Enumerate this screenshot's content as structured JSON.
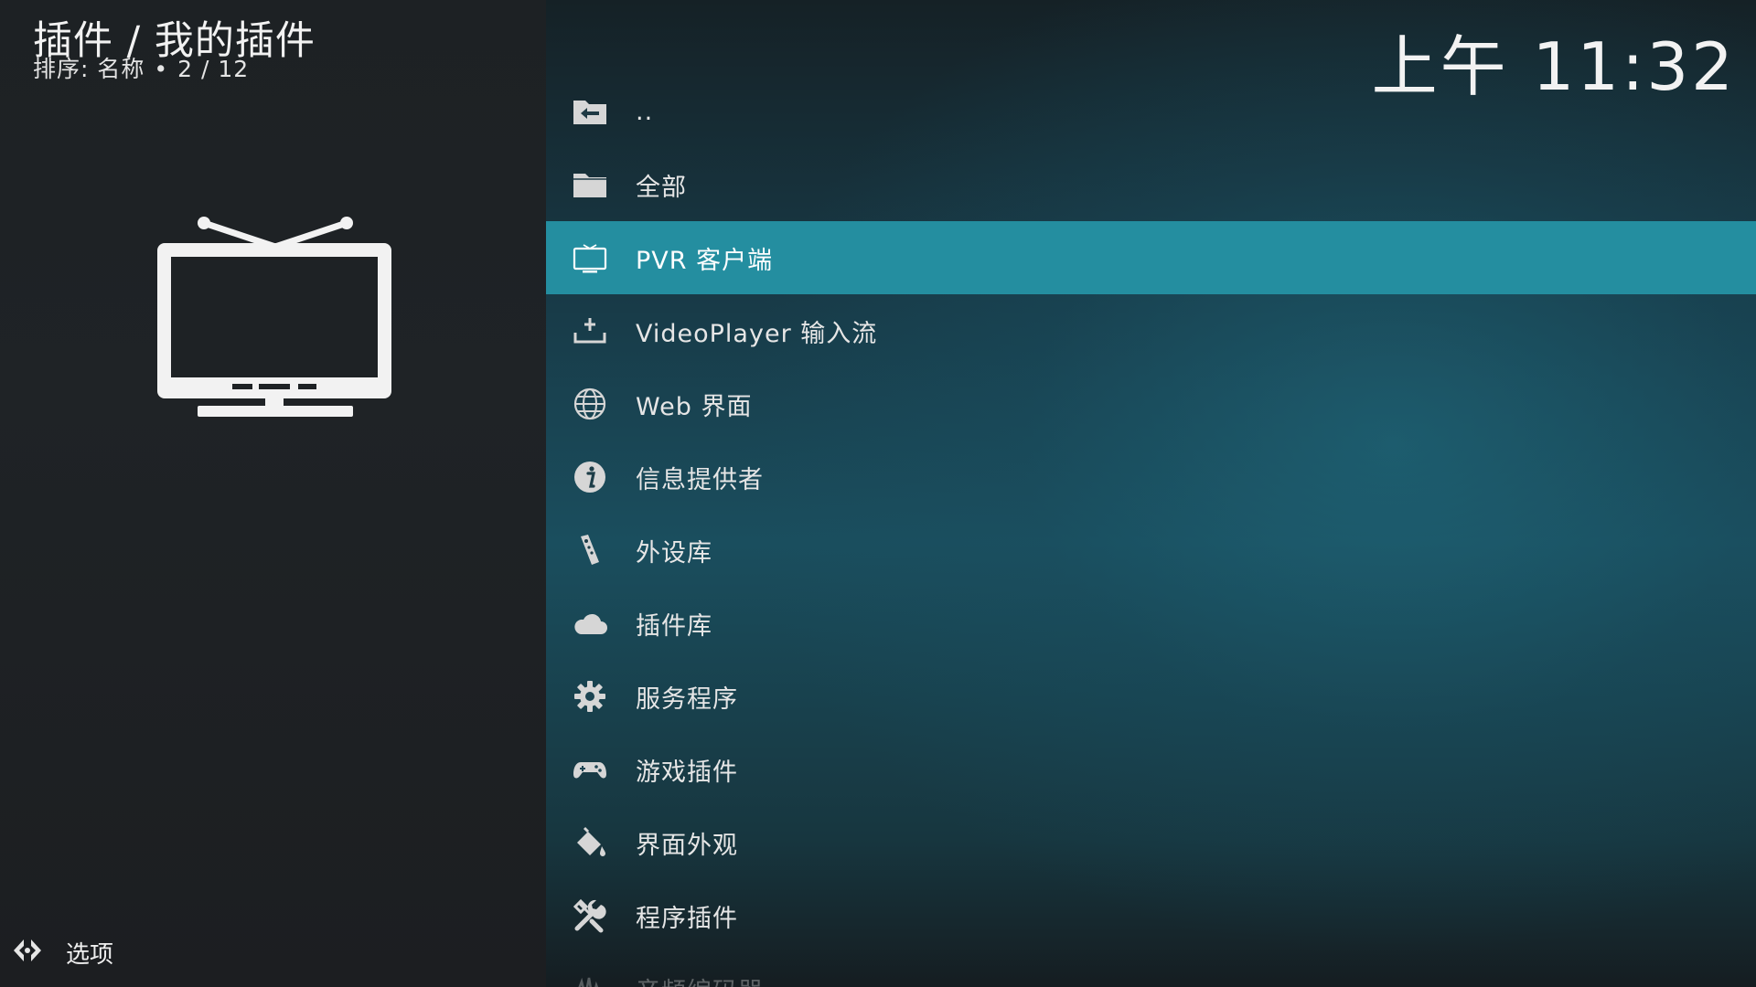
{
  "header": {
    "title": "插件 / 我的插件",
    "sort_label": "排序: 名称",
    "separator": "•",
    "position": "2 / 12"
  },
  "clock": "上午 11:32",
  "items": [
    {
      "label": "..",
      "icon": "folder-back-icon"
    },
    {
      "label": "全部",
      "icon": "folder-icon"
    },
    {
      "label": "PVR 客户端",
      "icon": "tv-icon",
      "selected": true
    },
    {
      "label": "VideoPlayer 输入流",
      "icon": "download-tray-icon"
    },
    {
      "label": "Web 界面",
      "icon": "globe-icon"
    },
    {
      "label": "信息提供者",
      "icon": "info-icon"
    },
    {
      "label": "外设库",
      "icon": "remote-control-icon"
    },
    {
      "label": "插件库",
      "icon": "cloud-icon"
    },
    {
      "label": "服务程序",
      "icon": "gear-icon"
    },
    {
      "label": "游戏插件",
      "icon": "gamepad-icon"
    },
    {
      "label": "界面外观",
      "icon": "paint-bucket-icon"
    },
    {
      "label": "程序插件",
      "icon": "tools-icon"
    },
    {
      "label": "音频编码器",
      "icon": "audio-waveform-icon"
    }
  ],
  "footer": {
    "options_label": "选项",
    "options_icon": "options-arrows-icon"
  },
  "colors": {
    "selected_bg": "#248ea0",
    "left_panel_bg": "#1d2124",
    "text": "#e6e6e6"
  }
}
